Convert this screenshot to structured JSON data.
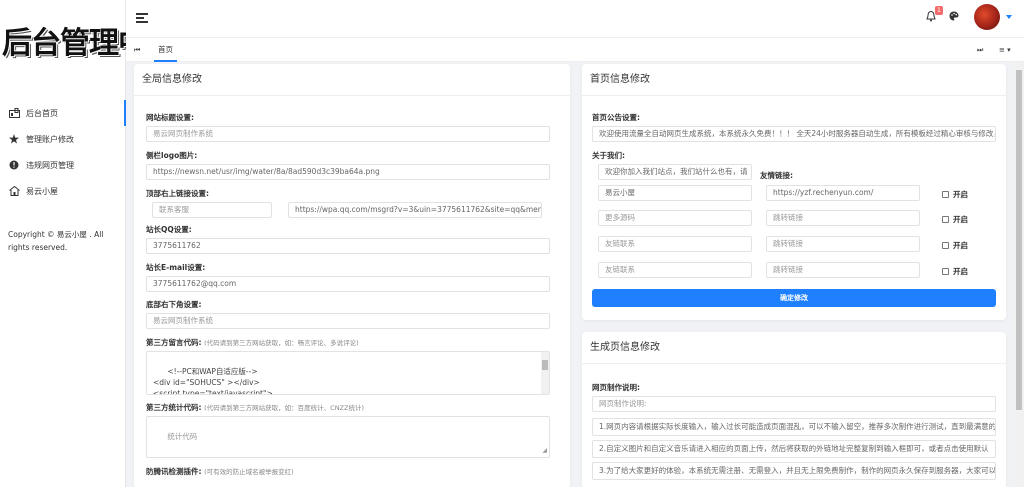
{
  "logo_text": "后台管理中心",
  "sidebar": {
    "items": [
      {
        "label": "后台首页",
        "icon": "dashboard-icon"
      },
      {
        "label": "管理账户修改",
        "icon": "star-icon"
      },
      {
        "label": "违规网页管理",
        "icon": "warning-icon"
      },
      {
        "label": "易云小屋",
        "icon": "house-icon"
      }
    ],
    "copyright": "Copyright © 易云小屋 . All rights reserved."
  },
  "header": {
    "notification_count": "1"
  },
  "tabs": {
    "home_label": "首页"
  },
  "global": {
    "title": "全局信息修改",
    "site_title_label": "网站标题设置:",
    "site_title_value": "易云网页制作系统",
    "logo_label": "侧栏logo图片:",
    "logo_value": "https://newsn.net/usr/img/water/8a/8ad590d3c39ba64a.png",
    "top_link_label": "顶部右上链接设置:",
    "top_link_text": "联系客服",
    "top_link_url": "https://wpa.qq.com/msgrd?v=3&uin=3775611762&site=qq&menu=",
    "qq_label": "站长QQ设置:",
    "qq_value": "3775611762",
    "email_label": "站长E-mail设置:",
    "email_value": "3775611762@qq.com",
    "footer_label": "底部右下角设置:",
    "footer_value": "易云网页制作系统",
    "comment_label": "第三方留言代码:",
    "comment_hint": "(代码请到第三方网站获取，如：畅言评论、多说评论)",
    "comment_code": "<!--PC和WAP自适应版-->\n<div id=\"SOHUCS\" ></div>\n<script type=\"text/javascript\">",
    "stats_label": "第三方统计代码:",
    "stats_hint": "(代码请到第三方网站获取，如：百度统计、CNZZ统计)",
    "stats_placeholder": "统计代码",
    "detect_label": "防腾讯检测插件:",
    "detect_hint": "(可有效的防止域名被举报变红)"
  },
  "home": {
    "title": "首页信息修改",
    "notice_label": "首页公告设置:",
    "notice_value": "欢迎使用流量全自动网页生成系统，本系统永久免费！！！ 全天24小时服务器自动生成，所有模板经过精心审核与修改，",
    "about_label": "关于我们:",
    "about_value": "欢迎你加入我们站点，我们站什么也有，请",
    "friend_label": "友情链接:",
    "links": [
      {
        "name": "易云小屋",
        "url": "https://yzf.rechenyun.com/",
        "enable": "开启"
      },
      {
        "name": "更多源码",
        "url": "跳转链接",
        "enable": "开启"
      },
      {
        "name": "友链联系",
        "url": "跳转链接",
        "enable": "开启"
      },
      {
        "name": "友链联系",
        "url": "跳转链接",
        "enable": "开启"
      }
    ],
    "submit_label": "确定修改"
  },
  "gen": {
    "title": "生成页信息修改",
    "desc_label": "网页制作说明:",
    "desc_placeholder": "网页制作说明:",
    "lines": [
      "1.网页内容请根据实际长度输入，输入过长可能造成页面混乱，可以不输入留空，推荐多次制作进行测试，直到最满意的",
      "2.自定义图片和自定义音乐请进入相应的页面上传，然后将获取的外链地址完整复制到输入框即可，或者点击使用默认",
      "3.为了给大家更好的体验，本系统无需注册、无需登入，并且无上限免费制作，制作的网页永久保存到服务器，大家可以"
    ]
  }
}
